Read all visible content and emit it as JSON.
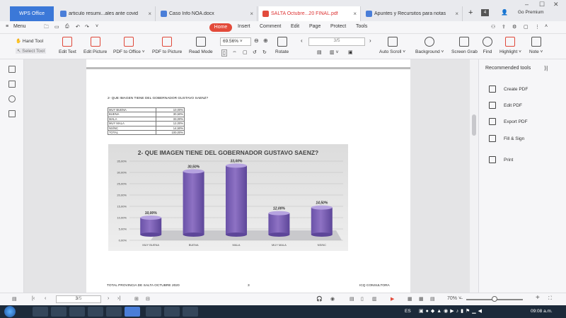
{
  "tabs": {
    "wps": "WPS Office",
    "items": [
      {
        "label": "articulo resumi...ales ante covid"
      },
      {
        "label": "Caso Info NOA.docx"
      },
      {
        "label": "SALTA  Octubre...20  FINAL.pdf"
      },
      {
        "label": "Apuntes y Recursitos para notas"
      }
    ],
    "tab_count": "4",
    "premium": "Go Premium"
  },
  "menubar": {
    "menu": "Menu",
    "items": [
      "Home",
      "Insert",
      "Comment",
      "Edit",
      "Page",
      "Protect",
      "Tools"
    ]
  },
  "toolbar": {
    "hand_tool": "Hand Tool",
    "select_tool": "Select Tool",
    "tools": [
      "Edit Text",
      "Edit Picture",
      "PDF to Office ˅",
      "PDF to Picture",
      "Read Mode"
    ],
    "zoom": "69.56%",
    "rotate": "Rotate",
    "page": "3/5",
    "tools_right": [
      "Auto Scroll ˅",
      "Background ˅",
      "Screen Grab",
      "Find",
      "Highlight ˅",
      "Note ˅"
    ]
  },
  "document": {
    "question": "2- QUE IMAGEN TIENE DEL GOBERNADOR GUSTAVO SAENZ?",
    "table": [
      {
        "label": "MUY BUENA",
        "value": "10,00%"
      },
      {
        "label": "BUENA",
        "value": "30,50%"
      },
      {
        "label": "MALA",
        "value": "33,00%"
      },
      {
        "label": "MUY MALA",
        "value": "12,00%"
      },
      {
        "label": "NS/NC",
        "value": "14,50%"
      },
      {
        "label": "TOTAL",
        "value": "100,00%"
      }
    ],
    "footer_left": "TOTAL PROVINCIA DE SALTA OCTUBRE 2020",
    "footer_page": "3",
    "footer_right": "ICQ CONSULTORA"
  },
  "chart_data": {
    "type": "bar",
    "title": "2- QUE IMAGEN TIENE DEL GOBERNADOR GUSTAVO SAENZ?",
    "categories": [
      "MUY BUENA",
      "BUENA",
      "MALA",
      "MUY MALA",
      "NS/NC"
    ],
    "values": [
      10.0,
      30.5,
      33.0,
      12.0,
      14.5
    ],
    "data_labels": [
      "10,00%",
      "30,50%",
      "33,00%",
      "12,00%",
      "14,50%"
    ],
    "yticks": [
      "0,00%",
      "5,00%",
      "10,00%",
      "15,00%",
      "20,00%",
      "25,00%",
      "30,00%",
      "35,00%"
    ],
    "ylim": [
      0,
      35
    ],
    "bar_color": "#8e72c4",
    "grid": true,
    "xlabel": "",
    "ylabel": ""
  },
  "right_panel": {
    "title": "Recommended tools",
    "items": [
      "Create PDF",
      "Edit PDF",
      "Export PDF",
      "Fill & Sign",
      "Print"
    ]
  },
  "statusbar": {
    "page": "3",
    "page_total": "/5",
    "zoom": "70% ˅"
  },
  "taskbar": {
    "lang": "ES",
    "time": "09:08 a.m."
  },
  "colors": {
    "accent": "#e34a3a",
    "wps_blue": "#3b78d8",
    "taskbar": "#1c2a3a"
  }
}
